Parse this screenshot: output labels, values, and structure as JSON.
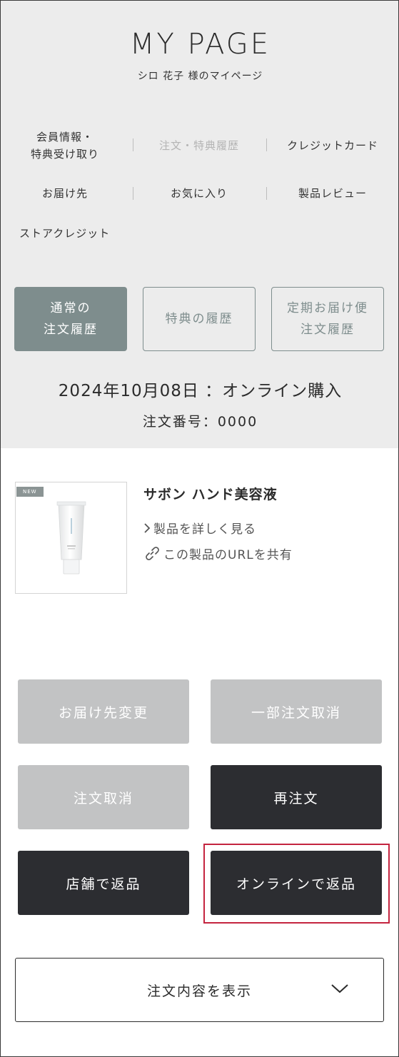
{
  "header": {
    "title": "MY PAGE",
    "subtitle": "シロ 花子 様のマイページ"
  },
  "nav": {
    "member_info_line1": "会員情報・",
    "member_info_line2": "特典受け取り",
    "order_history": "注文・特典履歴",
    "credit_card": "クレジットカード",
    "delivery_address": "お届け先",
    "favorites": "お気に入り",
    "product_review": "製品レビュー",
    "store_credit": "ストアクレジット"
  },
  "tabs": [
    {
      "label": "通常の\n注文履歴",
      "active": true
    },
    {
      "label": "特典の履歴",
      "active": false
    },
    {
      "label": "定期お届け便\n注文履歴",
      "active": false
    }
  ],
  "order": {
    "date_line": "2024年10月08日 ：オンライン購入",
    "number_line": "注文番号：0000"
  },
  "product": {
    "badge": "NEW",
    "name": "サボン ハンド美容液",
    "detail_link": "製品を詳しく見る",
    "share_link": "この製品のURLを共有"
  },
  "actions": {
    "change_address": "お届け先変更",
    "partial_cancel": "一部注文取消",
    "cancel_order": "注文取消",
    "reorder": "再注文",
    "store_return": "店舗で返品",
    "online_return": "オンラインで返品"
  },
  "details": {
    "toggle_label": "注文内容を表示"
  },
  "colors": {
    "accent_teal": "#7e8d8d",
    "button_dark": "#2c2d31",
    "button_disabled": "#c2c3c4",
    "highlight_red": "#c4243f",
    "header_bg": "#ececec"
  }
}
